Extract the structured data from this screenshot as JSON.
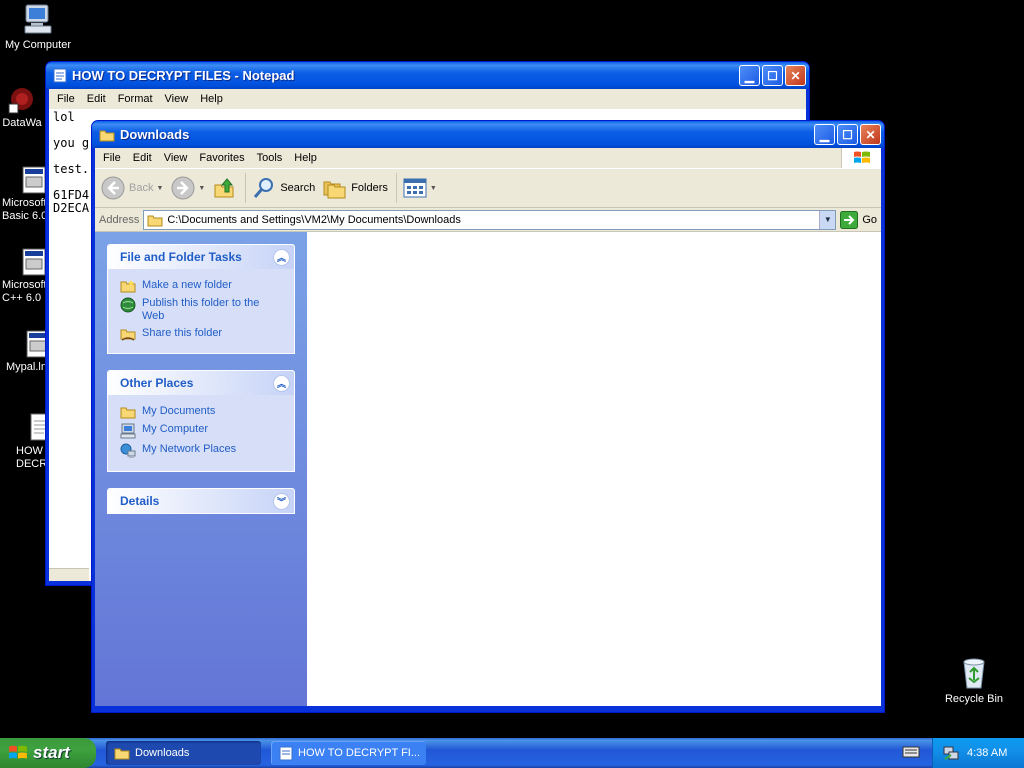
{
  "desktop": {
    "icons": [
      {
        "label": "My Computer"
      },
      {
        "label": "DataWa"
      },
      {
        "label": "Microsoft",
        "label2": "Basic 6.0"
      },
      {
        "label": "Microsoft",
        "label2": "C++ 6.0"
      },
      {
        "label": "Mypal.ln"
      },
      {
        "label": "HOW",
        "label2": "DECR"
      },
      {
        "label": "Recycle Bin"
      }
    ]
  },
  "notepad": {
    "title": "HOW TO DECRYPT FILES - Notepad",
    "menu": [
      "File",
      "Edit",
      "Format",
      "View",
      "Help"
    ],
    "lines": [
      "lol",
      "",
      "you g",
      "",
      "test.",
      "",
      "61FD4",
      "D2ECA"
    ]
  },
  "explorer": {
    "title": "Downloads",
    "menu": [
      "File",
      "Edit",
      "View",
      "Favorites",
      "Tools",
      "Help"
    ],
    "toolbar": {
      "back": "Back",
      "search": "Search",
      "folders": "Folders"
    },
    "address": {
      "label": "Address",
      "path": "C:\\Documents and Settings\\VM2\\My Documents\\Downloads",
      "go": "Go"
    },
    "tasks": {
      "title": "File and Folder Tasks",
      "items": [
        "Make a new folder",
        "Publish this folder to the Web",
        "Share this folder"
      ]
    },
    "places": {
      "title": "Other Places",
      "items": [
        "My Documents",
        "My Computer",
        "My Network Places"
      ]
    },
    "details": {
      "title": "Details"
    }
  },
  "taskbar": {
    "start": "start",
    "tasks": [
      "Downloads",
      "HOW TO DECRYPT FI..."
    ],
    "clock": "4:38 AM"
  },
  "colors": {
    "titlebar": "#0054e3",
    "taskpane": "#6f8fdf",
    "link": "#215dc6",
    "start": "#3ea13e"
  }
}
